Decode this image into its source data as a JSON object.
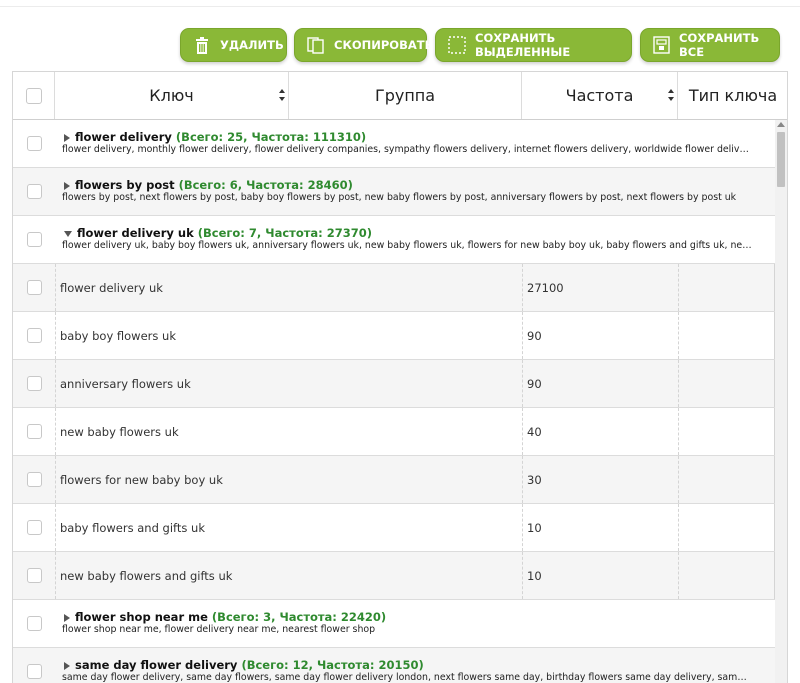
{
  "toolbar": {
    "delete_label": "УДАЛИТЬ",
    "copy_label": "СКОПИРОВАТЬ",
    "save_selected_label": "СОХРАНИТЬ ВЫДЕЛЕННЫЕ",
    "save_all_label": "СОХРАНИТЬ ВСЕ",
    "accent_color": "#8ab837"
  },
  "table": {
    "columns": {
      "key": "Ключ",
      "group": "Группа",
      "frequency": "Частота",
      "type": "Тип ключа"
    },
    "groups": [
      {
        "name": "flower delivery",
        "stats": "(Всего: 25, Частота: 111310)",
        "keywords": "flower delivery, monthly flower delivery, flower delivery companies, sympathy flowers delivery, internet flowers delivery, worldwide flower delivery, l...",
        "expanded": false
      },
      {
        "name": "flowers by post",
        "stats": "(Всего: 6, Частота: 28460)",
        "keywords": "flowers by post, next flowers by post, baby boy flowers by post, new baby flowers by post, anniversary flowers by post, next flowers by post uk",
        "expanded": false
      },
      {
        "name": "flower delivery uk",
        "stats": "(Всего: 7, Частота: 27370)",
        "keywords": "flower delivery uk, baby boy flowers uk, anniversary flowers uk, new baby flowers uk, flowers for new baby boy uk, baby flowers and gifts uk, new ba...",
        "expanded": true
      },
      {
        "name": "flower shop near me",
        "stats": "(Всего: 3, Частота: 22420)",
        "keywords": "flower shop near me, flower delivery near me, nearest flower shop",
        "expanded": false
      },
      {
        "name": "same day flower delivery",
        "stats": "(Всего: 12, Частота: 20150)",
        "keywords": "same day flower delivery, same day flowers, same day flower delivery london, next flowers same day, birthday flowers same day delivery, same day b...",
        "expanded": false
      }
    ],
    "rows": [
      {
        "key": "flower delivery uk",
        "frequency": "27100"
      },
      {
        "key": "baby boy flowers uk",
        "frequency": "90"
      },
      {
        "key": "anniversary flowers uk",
        "frequency": "90"
      },
      {
        "key": "new baby flowers uk",
        "frequency": "40"
      },
      {
        "key": "flowers for new baby boy uk",
        "frequency": "30"
      },
      {
        "key": "baby flowers and gifts uk",
        "frequency": "10"
      },
      {
        "key": "new baby flowers and gifts uk",
        "frequency": "10"
      }
    ]
  }
}
